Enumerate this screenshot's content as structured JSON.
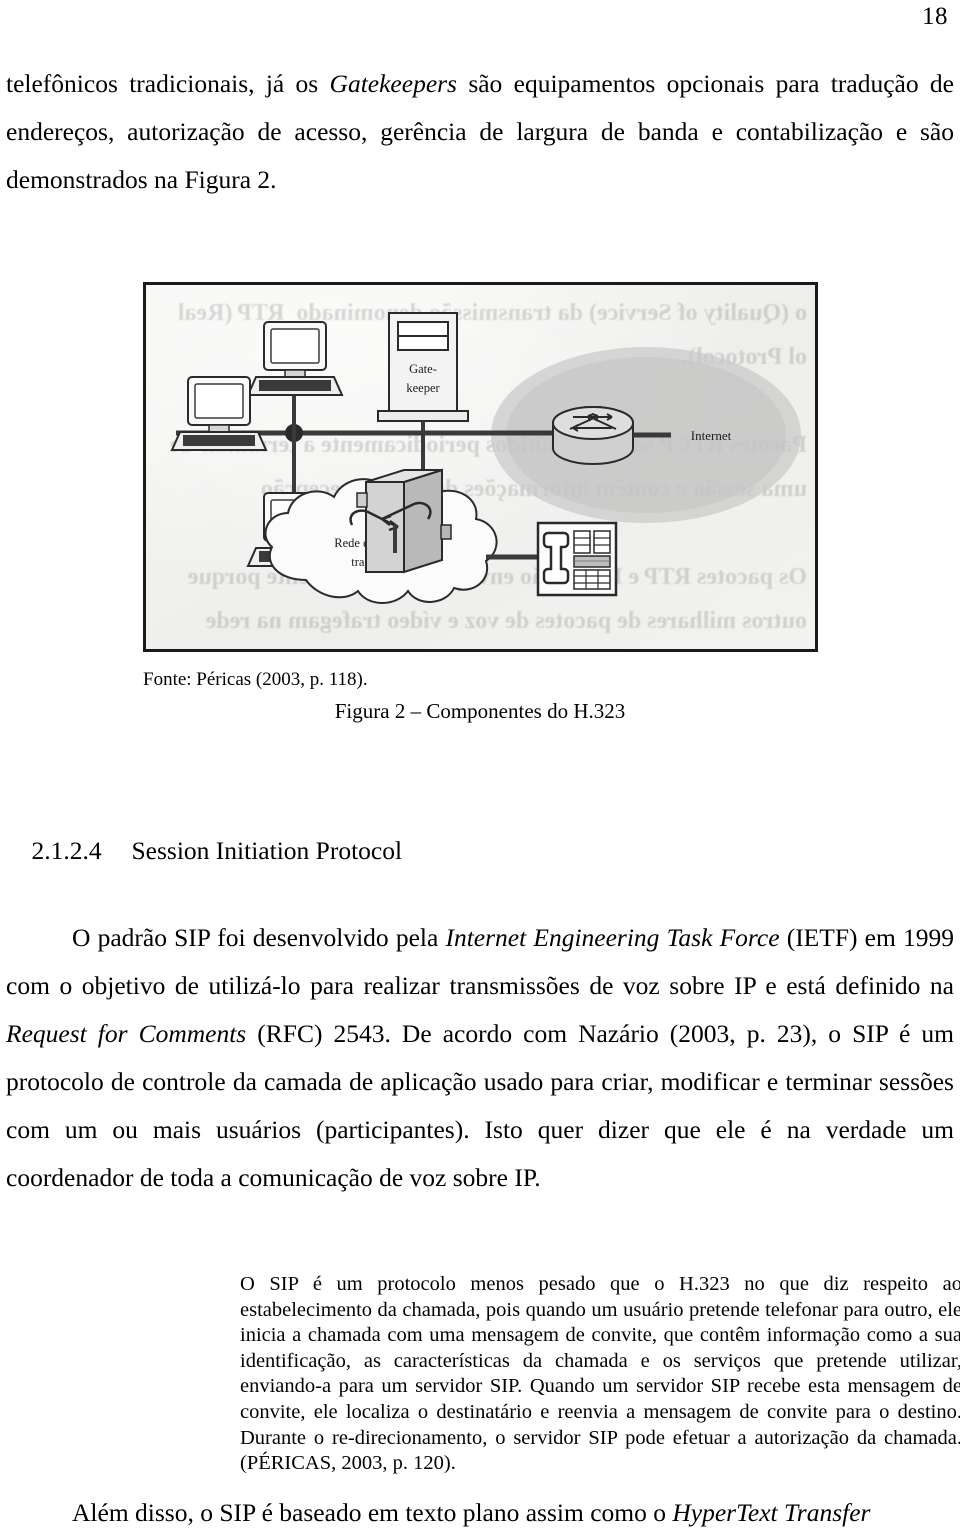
{
  "document": {
    "page_number": "18",
    "language": "pt-BR"
  },
  "paragraphs": {
    "intro_part1": "telefônicos tradicionais, já os ",
    "intro_italic": "Gatekeepers",
    "intro_part2": " são equipamentos opcionais para tradução de endereços, autorização de acesso, gerência de largura de banda e contabilização e são demonstrados na Figura 2."
  },
  "figure": {
    "source": "Fonte: Péricas (2003, p. 118).",
    "caption": "Figura 2 – Componentes do H.323",
    "labels": {
      "gatekeeper_line1": "Gate-",
      "gatekeeper_line2": "keeper",
      "internet": "Internet",
      "pstn_line1": "Rede de telefonia",
      "pstn_line2": "tradicional"
    },
    "bleed_through_text": "o (Quality of Service) da transmissão denominado  RTP (Real\nol Protocol).\n\nPacotes RTCP são transmitidos periodicamente a terminais de\numa sessão e contêm informações de envio e recepção\n\nOs pacotes RTP e RTCP são enviados continuamente porque\noutros milhares de pacotes de voz e vídeo trafegam na rede\nlogia a que são submetidos estes pacotes é tão específica\nstreaming de dados de vídeo transmitidos por o suporte para"
  },
  "heading": {
    "number": "2.1.2.4",
    "title": "Session Initiation Protocol"
  },
  "sip_paragraph": {
    "part1": "O padrão SIP foi desenvolvido pela ",
    "italic1": "Internet Engineering Task Force",
    "part2": " (IETF) em 1999 com o objetivo de utilizá-lo para realizar transmissões de voz sobre IP e está definido na ",
    "italic2": "Request for Comments",
    "part3": " (RFC) 2543. De acordo com Nazário (2003, p. 23), o SIP é um protocolo de controle da camada de aplicação usado para criar, modificar e terminar sessões com um ou mais usuários (participantes). Isto quer dizer que ele é na verdade um coordenador de toda a comunicação de voz sobre IP."
  },
  "quotation": {
    "text": "O SIP é um protocolo menos pesado que o H.323 no que diz respeito ao estabelecimento da chamada, pois quando um usuário pretende telefonar para outro, ele inicia a chamada com uma mensagem de convite, que contêm informação como a sua identificação, as características da chamada e os serviços que pretende utilizar, enviando-a para um servidor SIP. Quando um servidor SIP recebe esta mensagem de convite, ele localiza o destinatário e reenvia a mensagem de convite para o destino. Durante o re-direcionamento, o servidor SIP pode efetuar a autorização da chamada.",
    "citation": "(PÉRICAS, 2003, p. 120)."
  },
  "final_paragraph": {
    "part1": "Além disso, o SIP é baseado em texto plano assim como o ",
    "italic": "HyperText Transfer"
  }
}
